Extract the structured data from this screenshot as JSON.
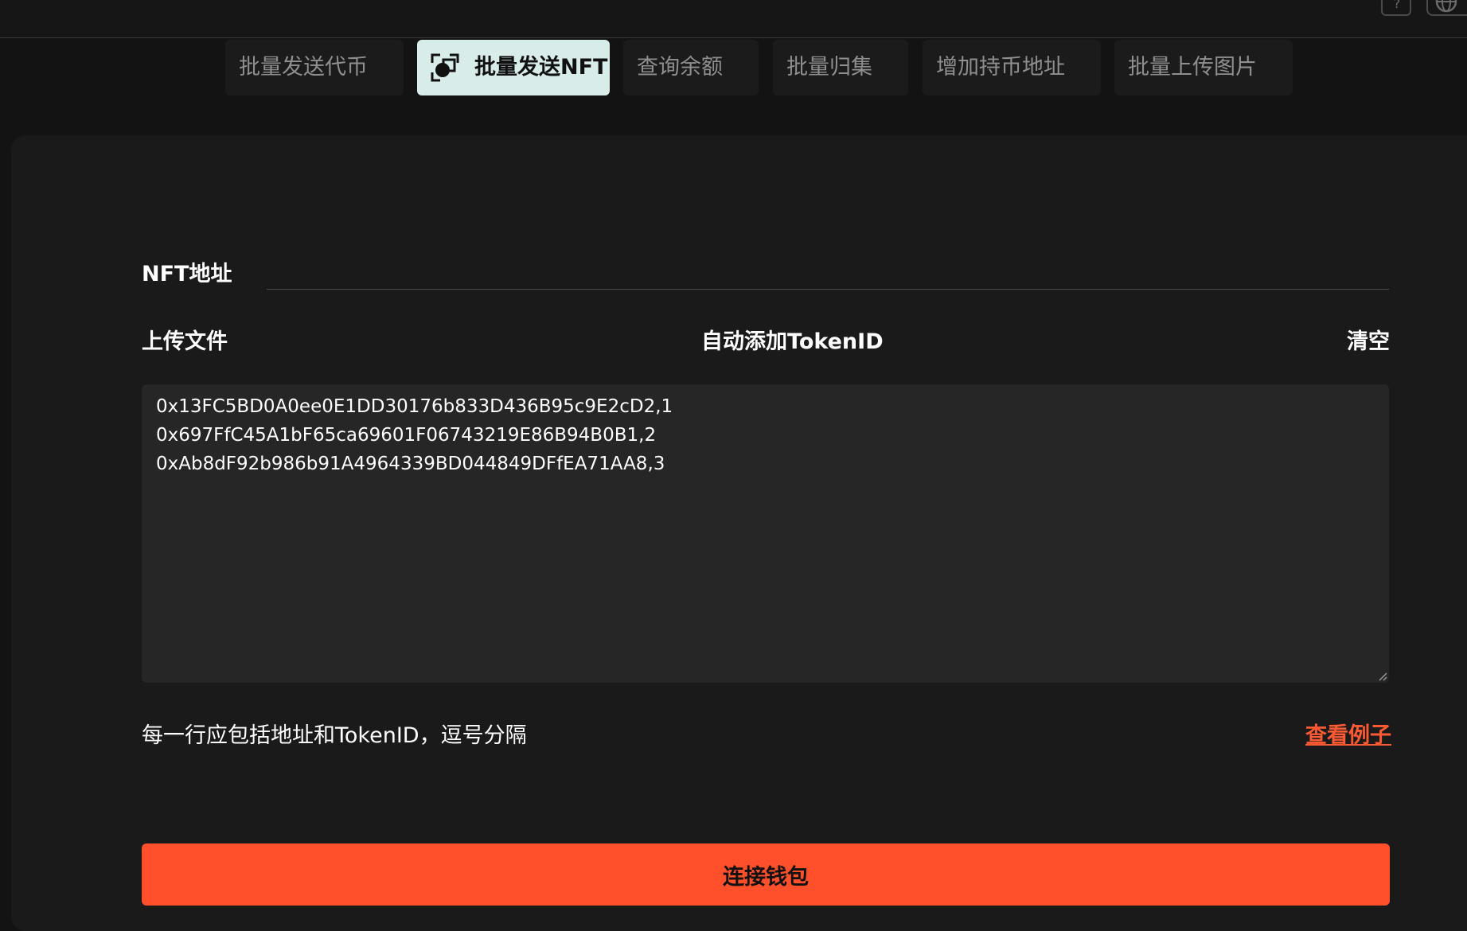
{
  "tabs": [
    {
      "label": "批量发送代币",
      "active": false
    },
    {
      "label": "批量发送NFT",
      "active": true
    },
    {
      "label": "查询余额",
      "active": false
    },
    {
      "label": "批量归集",
      "active": false
    },
    {
      "label": "增加持币地址",
      "active": false
    },
    {
      "label": "批量上传图片",
      "active": false
    }
  ],
  "form": {
    "nft_address_label": "NFT地址",
    "nft_address_value": "",
    "upload_file_label": "上传文件",
    "auto_add_tokenid_label": "自动添加TokenID",
    "clear_label": "清空",
    "address_lines": [
      "0x13FC5BD0A0ee0E1DD30176b833D436B95c9E2cD2,1",
      "0x697FfC45A1bF65ca69601F06743219E86B94B0B1,2",
      "0xAb8dF92b986b91A4964339BD044849DFfEA71AA8,3"
    ],
    "hint_text": "每一行应包括地址和TokenID，逗号分隔",
    "example_link_label": "查看例子",
    "connect_wallet_label": "连接钱包"
  },
  "colors": {
    "accent": "#ff4f2b",
    "active_tab_bg": "#d8ecea",
    "background": "#131313",
    "card_bg": "#1a1a1a",
    "textarea_bg": "#262626"
  },
  "icons": {
    "active_tab_icon": "nft-frame-icon",
    "top_help_icon": "help-icon",
    "top_lang_icon": "globe-icon"
  }
}
